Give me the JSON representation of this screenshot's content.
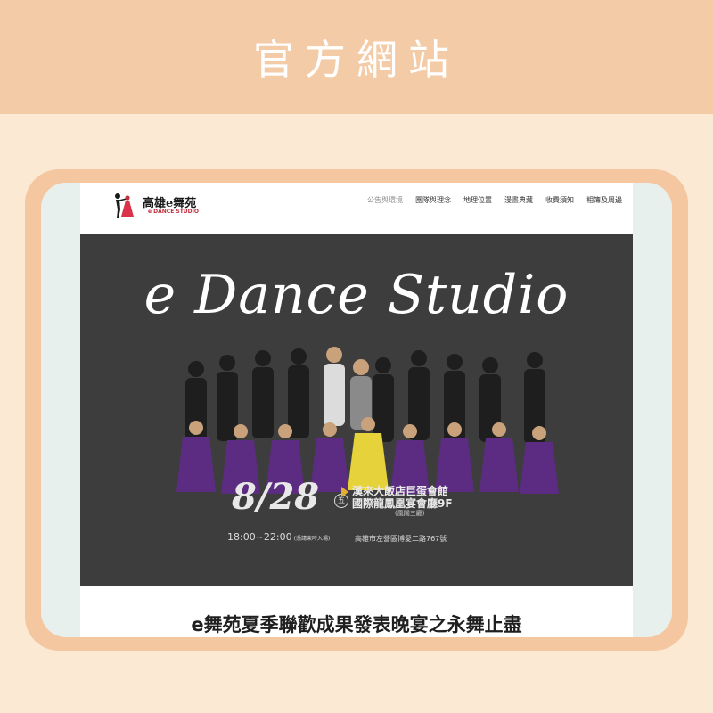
{
  "banner": {
    "title": "官方網站"
  },
  "site": {
    "logo": {
      "text": "高雄e舞苑",
      "subtext": "e DANCE STUDIO"
    },
    "nav": [
      {
        "label": "公告與環境",
        "active": true
      },
      {
        "label": "團隊與理念",
        "active": false
      },
      {
        "label": "地理位置",
        "active": false
      },
      {
        "label": "漫畫典藏",
        "active": false
      },
      {
        "label": "收費須知",
        "active": false
      },
      {
        "label": "相簿及周邊",
        "active": false
      }
    ],
    "hero": {
      "title": "e Dance Studio",
      "date": "8/28",
      "weekday": "五",
      "venue_line1": "漢來大飯店巨蛋會館",
      "venue_line2": "國際龍鳳凰宴會廳9F",
      "venue_note": "(凰閣三廳)",
      "time": "18:00~22:00",
      "time_note": "(憑請柬時入場)",
      "address": "高雄市左營區博愛二路767號"
    },
    "post_title": "e舞苑夏季聯歡成果發表晚宴之永舞止盡"
  },
  "colors": {
    "banner_bg": "#f3cba6",
    "page_bg": "#fbe9d4",
    "frame": "#f5c7a0",
    "hero_bg": "#3d3d3d",
    "dress_purple": "#5b2c82",
    "accent_gold": "#e0b030"
  }
}
